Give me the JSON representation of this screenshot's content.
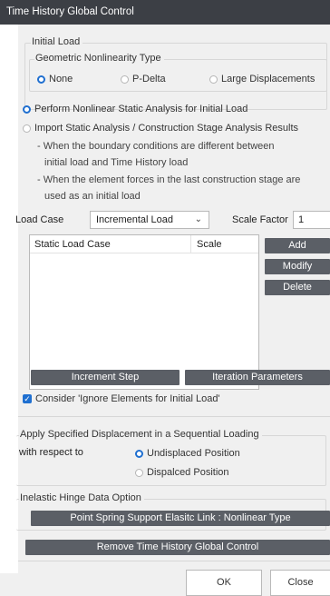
{
  "window": {
    "title": "Time History Global Control"
  },
  "initial_load": {
    "group_label": "Initial Load",
    "geo_nonlinearity": {
      "group_label": "Geometric Nonlinearity Type",
      "options": [
        "None",
        "P-Delta",
        "Large Displacements"
      ],
      "selected": "None"
    },
    "analysis_options": [
      "Perform Nonlinear Static Analysis for Initial Load",
      "Import Static Analysis / Construction Stage Analysis Results"
    ],
    "selected_analysis": "Perform Nonlinear Static Analysis for Initial Load",
    "notes": [
      "- When the boundary conditions are different between",
      "initial load and Time History load",
      "- When the element forces in the last construction stage are",
      "used as an initial load"
    ],
    "load_case_label": "Load Case",
    "load_case_value": "Incremental Load",
    "scale_factor_label": "Scale Factor",
    "scale_factor_value": "1",
    "table": {
      "columns": [
        "Static Load Case",
        "Scale"
      ],
      "rows": []
    },
    "buttons": {
      "add": "Add",
      "modify": "Modify",
      "delete": "Delete"
    },
    "increment_step": "Increment Step",
    "iteration_parameters": "Iteration Parameters",
    "ignore_elements_label": "Consider 'Ignore Elements for Initial Load'",
    "ignore_elements_checked": true
  },
  "sequential": {
    "group_label": "Apply Specified Displacement in a Sequential Loading",
    "respect_label": "with respect to",
    "options": [
      "Undisplaced Position",
      "Dispalced Position"
    ],
    "selected": "Undisplaced Position"
  },
  "hinge": {
    "group_label": "Inelastic Hinge Data Option",
    "button": "Point Spring Support  Elasitc Link : Nonlinear Type"
  },
  "remove_button": "Remove Time History Global Control",
  "footer": {
    "ok": "OK",
    "close": "Close"
  },
  "colors": {
    "accent": "#1f6fd0",
    "dark_button": "#5b5f66",
    "titlebar": "#3c3f45"
  }
}
